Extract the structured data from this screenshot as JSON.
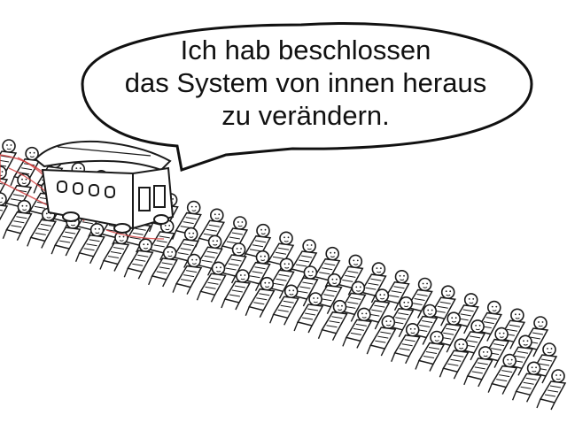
{
  "speech_bubble": {
    "lines": [
      "Ich hab beschlossen",
      "das System von innen heraus",
      "zu verändern."
    ]
  },
  "colors": {
    "ink": "#1a1a1a",
    "blood": "#d23a3a",
    "background": "#ffffff"
  },
  "icons": {
    "trolley": "trolley-icon",
    "people": "lying-people-icon"
  }
}
